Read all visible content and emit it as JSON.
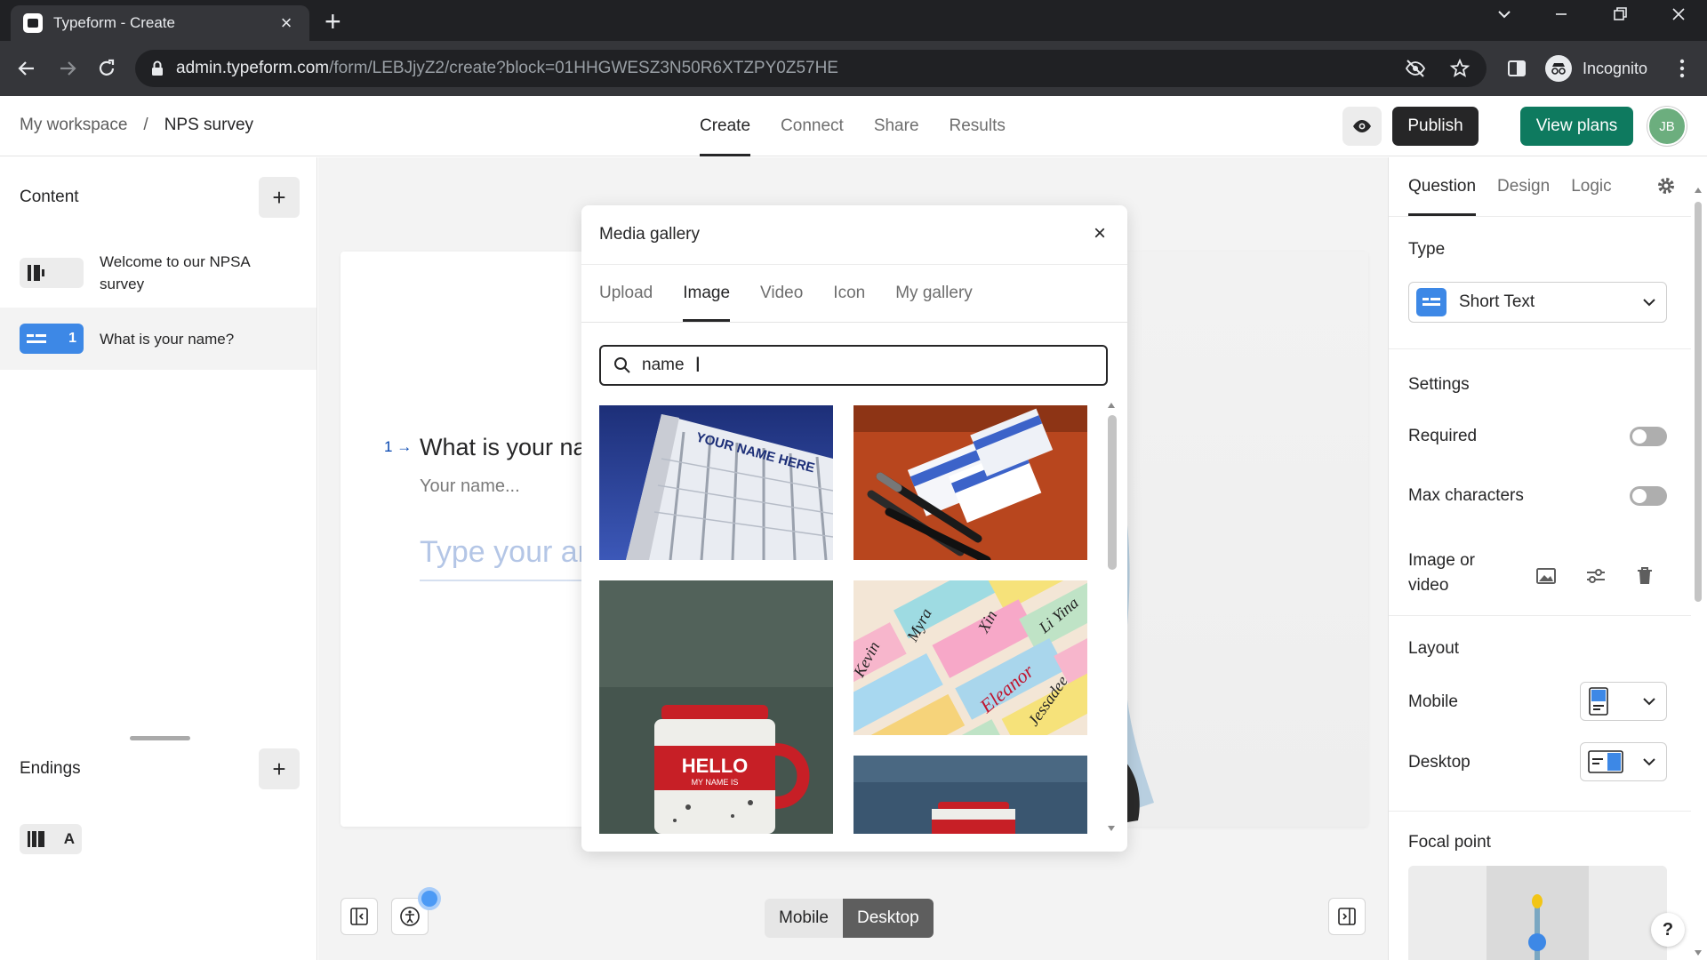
{
  "browser": {
    "tab_title": "Typeform - Create",
    "url_host": "admin.typeform.com",
    "url_path": "/form/LEBJjyZ2/create?block=01HHGWESZ3N50R6XTZPY0Z57HE",
    "profile_label": "Incognito"
  },
  "header": {
    "breadcrumb_workspace": "My workspace",
    "breadcrumb_separator": "/",
    "breadcrumb_form": "NPS survey",
    "nav": [
      "Create",
      "Connect",
      "Share",
      "Results"
    ],
    "active_nav": "Create",
    "publish_label": "Publish",
    "view_plans_label": "View plans",
    "avatar_initials": "JB"
  },
  "sidebar": {
    "content_title": "Content",
    "add_label": "+",
    "items": [
      {
        "label": "Welcome to our NPSA survey"
      },
      {
        "number": "1",
        "label": "What is your name?"
      }
    ],
    "endings_title": "Endings",
    "ending_letter": "A"
  },
  "canvas": {
    "question_number": "1",
    "question_title": "What is your na",
    "question_description": "Your name...",
    "answer_placeholder": "Type your ar",
    "view_mobile": "Mobile",
    "view_desktop": "Desktop"
  },
  "media_gallery": {
    "title": "Media gallery",
    "tabs": [
      "Upload",
      "Image",
      "Video",
      "Icon",
      "My gallery"
    ],
    "active_tab": "Image",
    "search_value": "name",
    "thumb_texts": {
      "building_sign": "YOUR NAME HERE",
      "mug_hello": "HELLO",
      "mug_subtext": "MY NAME IS",
      "names_collage": [
        "Kevin",
        "Myra",
        "Eleanor",
        "Li Yina",
        "Jessadee",
        "Xin"
      ]
    }
  },
  "right_panel": {
    "tabs": [
      "Question",
      "Design",
      "Logic"
    ],
    "active_tab": "Question",
    "type_section": "Type",
    "type_value": "Short Text",
    "settings_section": "Settings",
    "required_label": "Required",
    "required_on": false,
    "max_chars_label": "Max characters",
    "max_chars_on": false,
    "image_video_label": "Image or video",
    "layout_section": "Layout",
    "layout_mobile_label": "Mobile",
    "layout_desktop_label": "Desktop",
    "focal_point_section": "Focal point",
    "help_label": "?"
  },
  "colors": {
    "accent_blue": "#0445af",
    "type_icon_blue": "#3d88e6",
    "publish_bg": "#262627",
    "view_plans_bg": "#0e7a5f",
    "avatar_bg": "#6cae7e"
  }
}
